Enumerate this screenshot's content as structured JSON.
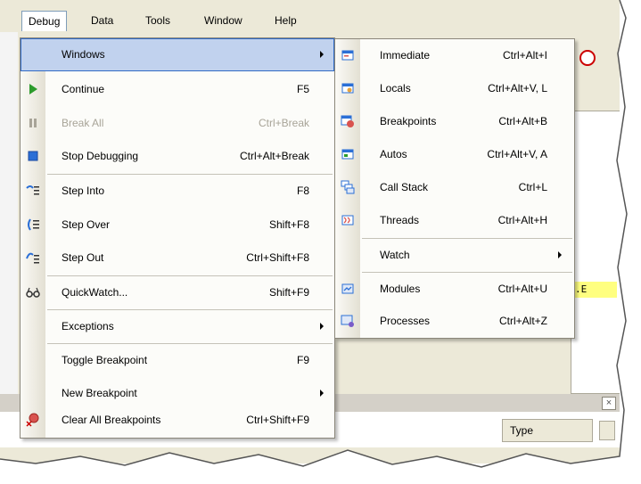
{
  "menubar": {
    "items": [
      "Debug",
      "Data",
      "Tools",
      "Window",
      "Help"
    ]
  },
  "debug_menu": {
    "items": [
      {
        "label": "Windows",
        "shortcut": "",
        "submenu": true,
        "icon": "none",
        "enabled": true
      },
      {
        "label": "Continue",
        "shortcut": "F5",
        "icon": "play-icon",
        "enabled": true
      },
      {
        "label": "Break All",
        "shortcut": "Ctrl+Break",
        "icon": "pause-icon",
        "enabled": false
      },
      {
        "label": "Stop Debugging",
        "shortcut": "Ctrl+Alt+Break",
        "icon": "stop-icon",
        "enabled": true
      },
      {
        "label": "Step Into",
        "shortcut": "F8",
        "icon": "step-into-icon",
        "enabled": true
      },
      {
        "label": "Step Over",
        "shortcut": "Shift+F8",
        "icon": "step-over-icon",
        "enabled": true
      },
      {
        "label": "Step Out",
        "shortcut": "Ctrl+Shift+F8",
        "icon": "step-out-icon",
        "enabled": true
      },
      {
        "label": "QuickWatch...",
        "shortcut": "Shift+F9",
        "icon": "glasses-icon",
        "enabled": true
      },
      {
        "label": "Exceptions",
        "shortcut": "",
        "submenu": true,
        "icon": "none",
        "enabled": true
      },
      {
        "label": "Toggle Breakpoint",
        "shortcut": "F9",
        "icon": "none",
        "enabled": true
      },
      {
        "label": "New Breakpoint",
        "shortcut": "",
        "submenu": true,
        "icon": "none",
        "enabled": true
      },
      {
        "label": "Clear All Breakpoints",
        "shortcut": "Ctrl+Shift+F9",
        "icon": "clear-breakpoints-icon",
        "enabled": true
      }
    ]
  },
  "windows_submenu": {
    "items": [
      {
        "label": "Immediate",
        "shortcut": "Ctrl+Alt+I",
        "icon": "immediate-window-icon"
      },
      {
        "label": "Locals",
        "shortcut": "Ctrl+Alt+V, L",
        "icon": "locals-window-icon"
      },
      {
        "label": "Breakpoints",
        "shortcut": "Ctrl+Alt+B",
        "icon": "breakpoints-window-icon"
      },
      {
        "label": "Autos",
        "shortcut": "Ctrl+Alt+V, A",
        "icon": "autos-window-icon"
      },
      {
        "label": "Call Stack",
        "shortcut": "Ctrl+L",
        "icon": "call-stack-icon"
      },
      {
        "label": "Threads",
        "shortcut": "Ctrl+Alt+H",
        "icon": "threads-icon"
      },
      {
        "label": "Watch",
        "shortcut": "",
        "submenu": true,
        "icon": "none"
      },
      {
        "label": "Modules",
        "shortcut": "Ctrl+Alt+U",
        "icon": "modules-icon"
      },
      {
        "label": "Processes",
        "shortcut": "Ctrl+Alt+Z",
        "icon": "processes-icon"
      }
    ]
  },
  "background": {
    "type_column_header": "Type",
    "code_fragment": ".E"
  },
  "colors": {
    "highlight": "#c1d2ee",
    "highlight_border": "#316ac5",
    "menu_bg": "#fcfcf9",
    "chrome": "#ece9d8"
  }
}
